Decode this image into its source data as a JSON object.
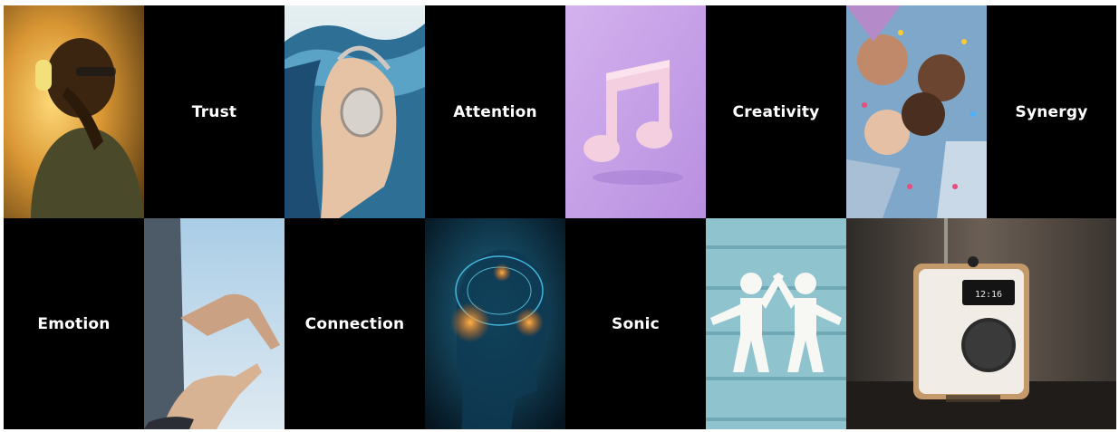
{
  "row1": {
    "words": [
      "Trust",
      "Attention",
      "Creativity",
      "Synergy"
    ]
  },
  "row2": {
    "words": [
      "Emotion",
      "Connection",
      "Sonic"
    ]
  },
  "radio": {
    "display_time": "12:16"
  },
  "colors": {
    "tile_background": "#000000",
    "text": "#ffffff",
    "music_tile": "#c9a6e8"
  },
  "images": {
    "row1": [
      "man-headphones-photo",
      "woman-headphones-waves-photo",
      "music-note-3d-photo",
      "friends-lying-circle-photo"
    ],
    "row2": [
      "reaching-hands-photo",
      "glowing-brain-head-photo",
      "paper-figures-highfive-photo",
      "wooden-radio-photo"
    ]
  }
}
